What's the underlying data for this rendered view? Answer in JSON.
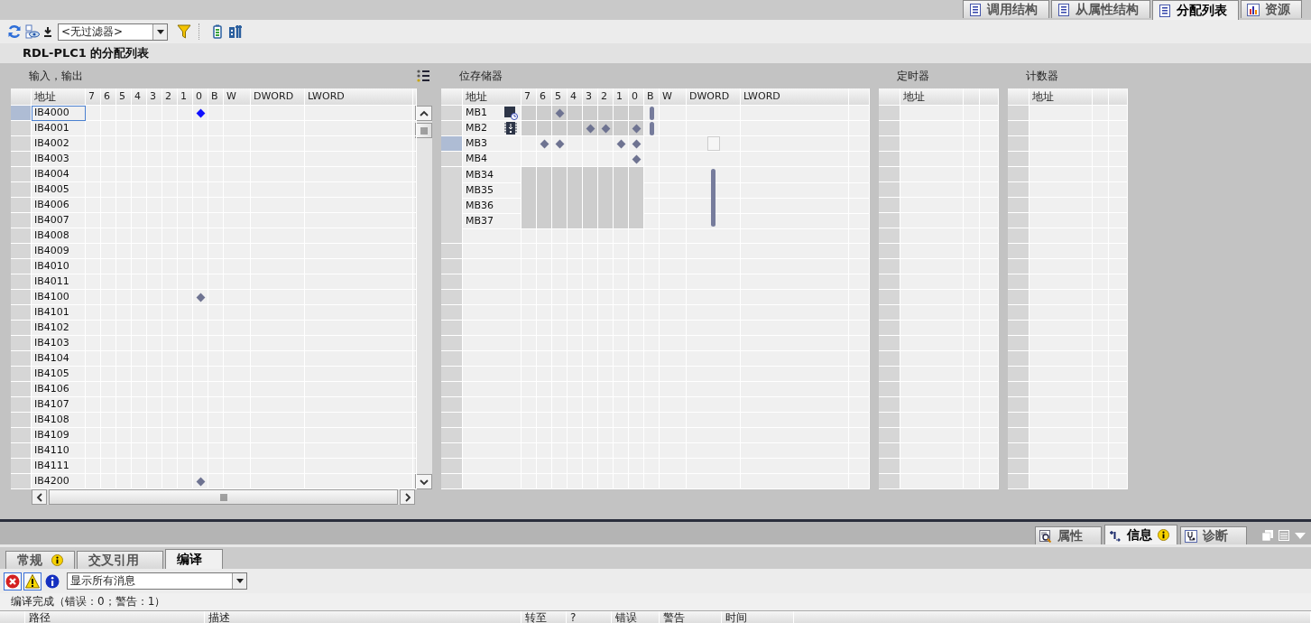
{
  "editor_tabs": [
    {
      "label": "调用结构",
      "selected": false
    },
    {
      "label": "从属性结构",
      "selected": false
    },
    {
      "label": "分配列表",
      "selected": true
    },
    {
      "label": "资源",
      "selected": false
    }
  ],
  "toolbar": {
    "filter": {
      "value": "<无过滤器>"
    }
  },
  "title": "RDL-PLC1 的分配列表",
  "io": {
    "title": "输入，输出",
    "columns": [
      "地址",
      "7",
      "6",
      "5",
      "4",
      "3",
      "2",
      "1",
      "0",
      "B",
      "W",
      "DWORD",
      "LWORD"
    ],
    "rows": [
      {
        "address": "IB4000",
        "selected": true,
        "focused": true,
        "bits": [
          false,
          false,
          false,
          false,
          false,
          false,
          false,
          true
        ]
      },
      {
        "address": "IB4001",
        "selected": false,
        "focused": false,
        "bits": [
          false,
          false,
          false,
          false,
          false,
          false,
          false,
          false
        ]
      },
      {
        "address": "IB4002",
        "selected": false,
        "focused": false,
        "bits": [
          false,
          false,
          false,
          false,
          false,
          false,
          false,
          false
        ]
      },
      {
        "address": "IB4003",
        "selected": false,
        "focused": false,
        "bits": [
          false,
          false,
          false,
          false,
          false,
          false,
          false,
          false
        ]
      },
      {
        "address": "IB4004",
        "selected": false,
        "focused": false,
        "bits": [
          false,
          false,
          false,
          false,
          false,
          false,
          false,
          false
        ]
      },
      {
        "address": "IB4005",
        "selected": false,
        "focused": false,
        "bits": [
          false,
          false,
          false,
          false,
          false,
          false,
          false,
          false
        ]
      },
      {
        "address": "IB4006",
        "selected": false,
        "focused": false,
        "bits": [
          false,
          false,
          false,
          false,
          false,
          false,
          false,
          false
        ]
      },
      {
        "address": "IB4007",
        "selected": false,
        "focused": false,
        "bits": [
          false,
          false,
          false,
          false,
          false,
          false,
          false,
          false
        ]
      },
      {
        "address": "IB4008",
        "selected": false,
        "focused": false,
        "bits": [
          false,
          false,
          false,
          false,
          false,
          false,
          false,
          false
        ]
      },
      {
        "address": "IB4009",
        "selected": false,
        "focused": false,
        "bits": [
          false,
          false,
          false,
          false,
          false,
          false,
          false,
          false
        ]
      },
      {
        "address": "IB4010",
        "selected": false,
        "focused": false,
        "bits": [
          false,
          false,
          false,
          false,
          false,
          false,
          false,
          false
        ]
      },
      {
        "address": "IB4011",
        "selected": false,
        "focused": false,
        "bits": [
          false,
          false,
          false,
          false,
          false,
          false,
          false,
          false
        ]
      },
      {
        "address": "IB4100",
        "selected": false,
        "focused": false,
        "bits": [
          false,
          false,
          false,
          false,
          false,
          false,
          false,
          true
        ]
      },
      {
        "address": "IB4101",
        "selected": false,
        "focused": false,
        "bits": [
          false,
          false,
          false,
          false,
          false,
          false,
          false,
          false
        ]
      },
      {
        "address": "IB4102",
        "selected": false,
        "focused": false,
        "bits": [
          false,
          false,
          false,
          false,
          false,
          false,
          false,
          false
        ]
      },
      {
        "address": "IB4103",
        "selected": false,
        "focused": false,
        "bits": [
          false,
          false,
          false,
          false,
          false,
          false,
          false,
          false
        ]
      },
      {
        "address": "IB4104",
        "selected": false,
        "focused": false,
        "bits": [
          false,
          false,
          false,
          false,
          false,
          false,
          false,
          false
        ]
      },
      {
        "address": "IB4105",
        "selected": false,
        "focused": false,
        "bits": [
          false,
          false,
          false,
          false,
          false,
          false,
          false,
          false
        ]
      },
      {
        "address": "IB4106",
        "selected": false,
        "focused": false,
        "bits": [
          false,
          false,
          false,
          false,
          false,
          false,
          false,
          false
        ]
      },
      {
        "address": "IB4107",
        "selected": false,
        "focused": false,
        "bits": [
          false,
          false,
          false,
          false,
          false,
          false,
          false,
          false
        ]
      },
      {
        "address": "IB4108",
        "selected": false,
        "focused": false,
        "bits": [
          false,
          false,
          false,
          false,
          false,
          false,
          false,
          false
        ]
      },
      {
        "address": "IB4109",
        "selected": false,
        "focused": false,
        "bits": [
          false,
          false,
          false,
          false,
          false,
          false,
          false,
          false
        ]
      },
      {
        "address": "IB4110",
        "selected": false,
        "focused": false,
        "bits": [
          false,
          false,
          false,
          false,
          false,
          false,
          false,
          false
        ]
      },
      {
        "address": "IB4111",
        "selected": false,
        "focused": false,
        "bits": [
          false,
          false,
          false,
          false,
          false,
          false,
          false,
          false
        ]
      },
      {
        "address": "IB4200",
        "selected": false,
        "focused": false,
        "bits": [
          false,
          false,
          false,
          false,
          false,
          false,
          false,
          true
        ]
      }
    ]
  },
  "memory": {
    "title": "位存储器",
    "columns": [
      "地址",
      "7",
      "6",
      "5",
      "4",
      "3",
      "2",
      "1",
      "0",
      "B",
      "W",
      "DWORD",
      "LWORD"
    ],
    "rows": [
      {
        "address": "MB1",
        "selected": false,
        "focused": false,
        "shaded": true,
        "byte": true,
        "dword": false,
        "bits": [
          false,
          false,
          true,
          false,
          false,
          false,
          false,
          false
        ]
      },
      {
        "address": "MB2",
        "selected": false,
        "focused": false,
        "shaded": true,
        "byte": true,
        "dword": false,
        "bits": [
          false,
          false,
          false,
          false,
          true,
          true,
          false,
          true
        ]
      },
      {
        "address": "MB3",
        "selected": true,
        "focused": true,
        "shaded": false,
        "byte": false,
        "dword": false,
        "bits": [
          false,
          true,
          true,
          false,
          false,
          false,
          true,
          true
        ]
      },
      {
        "address": "MB4",
        "selected": false,
        "focused": false,
        "shaded": false,
        "byte": false,
        "dword": false,
        "bits": [
          false,
          false,
          false,
          false,
          false,
          false,
          false,
          true
        ]
      },
      {
        "address": "MB34",
        "selected": false,
        "focused": false,
        "shaded": true,
        "byte": false,
        "dword": true,
        "bits": [
          false,
          false,
          false,
          false,
          false,
          false,
          false,
          false
        ]
      },
      {
        "address": "MB35",
        "selected": false,
        "focused": false,
        "shaded": true,
        "byte": false,
        "dword": true,
        "bits": [
          false,
          false,
          false,
          false,
          false,
          false,
          false,
          false
        ]
      },
      {
        "address": "MB36",
        "selected": false,
        "focused": false,
        "shaded": true,
        "byte": false,
        "dword": true,
        "bits": [
          false,
          false,
          false,
          false,
          false,
          false,
          false,
          false
        ]
      },
      {
        "address": "MB37",
        "selected": false,
        "focused": false,
        "shaded": true,
        "byte": false,
        "dword": true,
        "bits": [
          false,
          false,
          false,
          false,
          false,
          false,
          false,
          false
        ]
      }
    ]
  },
  "timers": {
    "title": "定时器",
    "columns": [
      "地址"
    ]
  },
  "counters": {
    "title": "计数器",
    "columns": [
      "地址"
    ]
  },
  "inspector_tabs": [
    {
      "label": "属性",
      "selected": false,
      "badge": false
    },
    {
      "label": "信息",
      "selected": true,
      "badge": true
    },
    {
      "label": "诊断",
      "selected": false,
      "badge": false
    }
  ],
  "info_tabs": [
    {
      "label": "常规",
      "selected": false,
      "badge": true
    },
    {
      "label": "交叉引用",
      "selected": false,
      "badge": false
    },
    {
      "label": "编译",
      "selected": true,
      "badge": false
    }
  ],
  "message_filters": [
    {
      "kind": "error",
      "pressed": true
    },
    {
      "kind": "warning",
      "pressed": true
    },
    {
      "kind": "info",
      "pressed": false
    }
  ],
  "message_dropdown": {
    "value": "显示所有消息"
  },
  "status": "编译完成（错误：0；警告：1）",
  "message_columns": [
    "路径",
    "描述",
    "转至",
    "?",
    "错误",
    "警告",
    "时间"
  ]
}
